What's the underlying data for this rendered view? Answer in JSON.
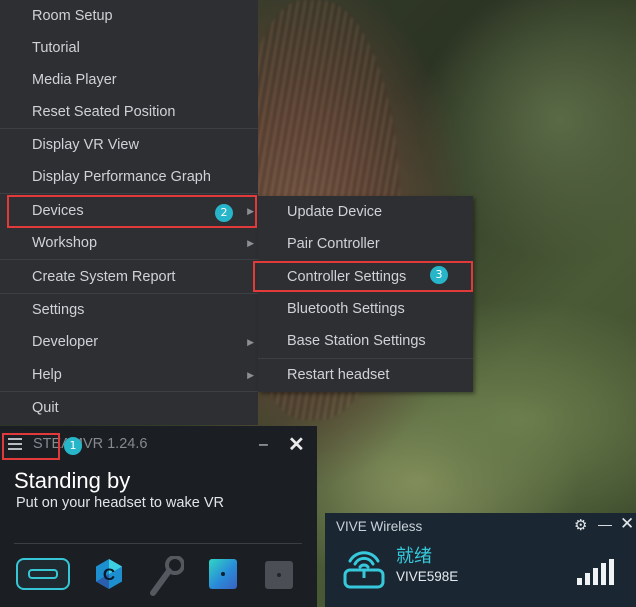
{
  "main_menu": {
    "items": [
      {
        "label": "Room Setup",
        "submenu": false
      },
      {
        "label": "Tutorial",
        "submenu": false
      },
      {
        "label": "Media Player",
        "submenu": false
      },
      {
        "label": "Reset Seated Position",
        "submenu": false
      },
      {
        "label": "Display VR View",
        "submenu": false
      },
      {
        "label": "Display Performance Graph",
        "submenu": false
      },
      {
        "label": "Devices",
        "submenu": true
      },
      {
        "label": "Workshop",
        "submenu": true
      },
      {
        "label": "Create System Report",
        "submenu": false
      },
      {
        "label": "Settings",
        "submenu": false
      },
      {
        "label": "Developer",
        "submenu": true
      },
      {
        "label": "Help",
        "submenu": true
      },
      {
        "label": "Quit",
        "submenu": false
      }
    ],
    "arrow_glyph": "▶"
  },
  "devices_submenu": {
    "items": [
      {
        "label": "Update Device"
      },
      {
        "label": "Pair Controller"
      },
      {
        "label": "Controller Settings"
      },
      {
        "label": "Bluetooth Settings"
      },
      {
        "label": "Base Station Settings"
      },
      {
        "label": "Restart headset"
      }
    ]
  },
  "annotations": {
    "step1": "1",
    "step2": "2",
    "step3": "3",
    "highlight_color": "#e23a3a",
    "badge_color": "#27b6c9"
  },
  "steamvr": {
    "title": "STEAMVR 1.24.6",
    "status": "Standing by",
    "subtitle": "Put on your headset to wake VR",
    "minimize": "–",
    "close": "✕",
    "devices": [
      "headset-icon",
      "controller-c-icon",
      "wand-controller-icon",
      "base-station-icon",
      "tracker-box-icon"
    ],
    "accent": "#36c6d6"
  },
  "vive_wireless": {
    "title": "VIVE Wireless",
    "status": "就绪",
    "device_id": "VIVE598E",
    "gear": "⚙",
    "minimize": "—",
    "close": "✕",
    "accent": "#36c9dc"
  }
}
